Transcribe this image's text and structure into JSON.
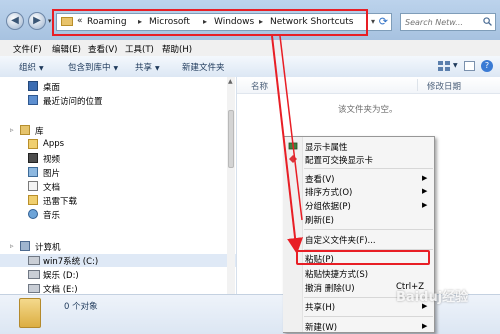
{
  "address_bar": {
    "prefix": "«",
    "crumbs": [
      "Roaming",
      "Microsoft",
      "Windows",
      "Network Shortcuts"
    ],
    "separator": "▸"
  },
  "search": {
    "placeholder": "Search Netw..."
  },
  "menubar": [
    "文件(F)",
    "编辑(E)",
    "查看(V)",
    "工具(T)",
    "帮助(H)"
  ],
  "toolbar": {
    "organize": "组织",
    "include_in_library": "包含到库中",
    "share": "共享",
    "new_folder": "新建文件夹"
  },
  "navpane": {
    "favorites": [
      {
        "label": "桌面",
        "icon": "desktop-icon"
      },
      {
        "label": "最近访问的位置",
        "icon": "recent-places-icon"
      }
    ],
    "libraries_label": "库",
    "libraries": [
      {
        "label": "Apps",
        "icon": "folder-icon"
      },
      {
        "label": "视频",
        "icon": "videos-icon"
      },
      {
        "label": "图片",
        "icon": "pictures-icon"
      },
      {
        "label": "文档",
        "icon": "documents-icon"
      },
      {
        "label": "迅雷下载",
        "icon": "folder-icon"
      },
      {
        "label": "音乐",
        "icon": "music-icon"
      }
    ],
    "computer_label": "计算机",
    "drives": [
      {
        "label": "win7系统 (C:)",
        "icon": "drive-icon"
      },
      {
        "label": "娱乐 (D:)",
        "icon": "drive-icon"
      },
      {
        "label": "文档 (E:)",
        "icon": "drive-icon"
      }
    ]
  },
  "content": {
    "columns": [
      "名称",
      "修改日期"
    ],
    "empty_message": "该文件夹为空。"
  },
  "context_menu": [
    {
      "label": "显示卡属性",
      "icon": "display-card-icon"
    },
    {
      "label": "配置可交换显示卡",
      "icon": "switchable-graphics-icon"
    },
    {
      "separator": true
    },
    {
      "label": "查看(V)",
      "submenu": true
    },
    {
      "label": "排序方式(O)",
      "submenu": true
    },
    {
      "label": "分组依据(P)",
      "submenu": true
    },
    {
      "label": "刷新(E)"
    },
    {
      "separator": true
    },
    {
      "label": "自定义文件夹(F)..."
    },
    {
      "separator": true
    },
    {
      "label": "粘贴(P)",
      "highlighted": true
    },
    {
      "label": "粘贴快捷方式(S)"
    },
    {
      "label": "撤消 删除(U)",
      "shortcut": "Ctrl+Z"
    },
    {
      "separator": true
    },
    {
      "label": "共享(H)",
      "submenu": true
    },
    {
      "separator": true
    },
    {
      "label": "新建(W)",
      "submenu": true
    }
  ],
  "statusbar": {
    "text": "0 个对象"
  },
  "watermark": "Baiduj经验",
  "colors": {
    "annotation": "#e81e25",
    "accent": "#1e395b"
  }
}
